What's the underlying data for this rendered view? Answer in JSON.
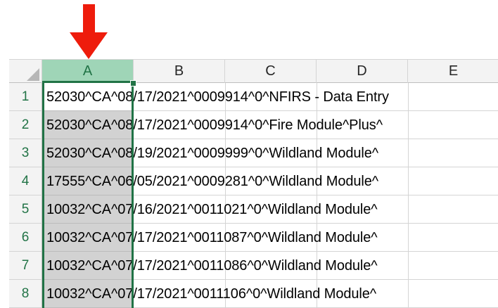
{
  "colors": {
    "selection": "#217346",
    "selected_header_bg": "#9fd5b7",
    "selected_cells_bg": "#d2d2d2",
    "arrow": "#ee1c0c"
  },
  "annotation": {
    "icon": "red-down-arrow-icon"
  },
  "columns": [
    "A",
    "B",
    "C",
    "D",
    "E"
  ],
  "selected_column": "A",
  "rows": [
    {
      "num": "1",
      "text": "52030^CA^08/17/2021^0009914^0^NFIRS - Data Entry"
    },
    {
      "num": "2",
      "text": "52030^CA^08/17/2021^0009914^0^Fire Module^Plus^"
    },
    {
      "num": "3",
      "text": "52030^CA^08/19/2021^0009999^0^Wildland Module^"
    },
    {
      "num": "4",
      "text": "17555^CA^06/05/2021^0009281^0^Wildland Module^"
    },
    {
      "num": "5",
      "text": "10032^CA^07/16/2021^0011021^0^Wildland Module^"
    },
    {
      "num": "6",
      "text": "10032^CA^07/17/2021^0011087^0^Wildland Module^"
    },
    {
      "num": "7",
      "text": "10032^CA^07/17/2021^0011086^0^Wildland Module^"
    },
    {
      "num": "8",
      "text": "10032^CA^07/17/2021^0011106^0^Wildland Module^"
    }
  ]
}
